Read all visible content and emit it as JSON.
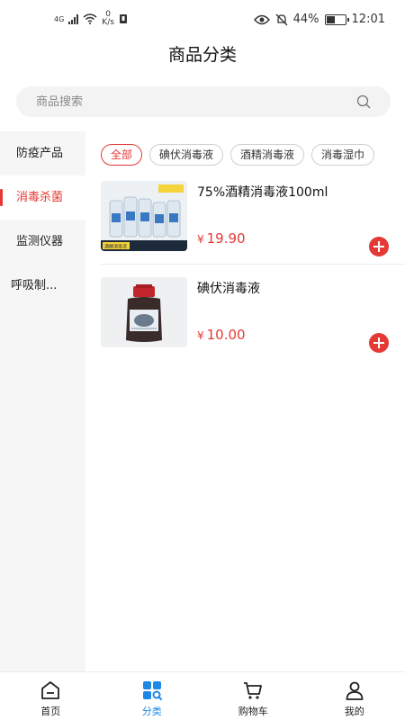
{
  "status_bar": {
    "network": "4G",
    "speed_value": "0",
    "speed_unit": "K/s",
    "battery": "44%",
    "time": "12:01"
  },
  "header": {
    "title": "商品分类"
  },
  "search": {
    "placeholder": "商品搜索"
  },
  "sidebar": {
    "items": [
      {
        "label": "防疫产品",
        "active": false
      },
      {
        "label": "消毒杀菌",
        "active": true
      },
      {
        "label": "监测仪器",
        "active": false
      },
      {
        "label": "呼吸制...",
        "active": false
      }
    ]
  },
  "tags": [
    {
      "label": "全部",
      "active": true
    },
    {
      "label": "碘伏消毒液",
      "active": false
    },
    {
      "label": "酒精消毒液",
      "active": false
    },
    {
      "label": "消毒湿巾",
      "active": false
    }
  ],
  "products": [
    {
      "name": "75%酒精消毒液100ml",
      "currency": "¥",
      "price": "19.90",
      "image_label": "酒精消毒液"
    },
    {
      "name": "碘伏消毒液",
      "currency": "¥",
      "price": "10.00"
    }
  ],
  "tabbar": {
    "items": [
      {
        "label": "首页",
        "icon": "home-icon",
        "active": false
      },
      {
        "label": "分类",
        "icon": "category-icon",
        "active": true
      },
      {
        "label": "购物车",
        "icon": "cart-icon",
        "active": false
      },
      {
        "label": "我的",
        "icon": "user-icon",
        "active": false
      }
    ]
  },
  "colors": {
    "accent": "#e53935",
    "tab_active": "#1e88e5"
  }
}
